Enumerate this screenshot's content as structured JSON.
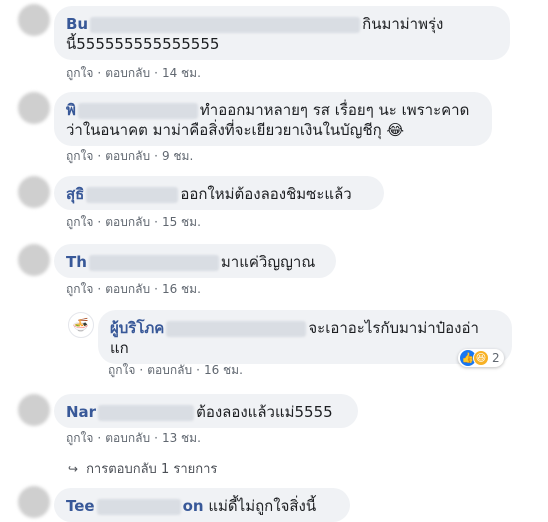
{
  "comments": [
    {
      "name": "Bu",
      "text": "กินมาม่าพรุ่งนี้555555555555555",
      "time": "14 ชม."
    },
    {
      "name": "พิ",
      "text": "ทำออกมาหลายๆ รส เรื่อยๆ นะ เพราะคาดว่าในอนาคต มาม่าคือสิ่งที่จะเยียวยาเงินในบัญชีกุ",
      "emoji": "😂",
      "time": "9 ชม."
    },
    {
      "name": "สุธิ",
      "text": "ออกใหม่ต้องลองชิมซะแล้ว",
      "time": "15 ชม."
    },
    {
      "name": "Th",
      "text": "มาแค่วิญญาณ",
      "time": "16 ชม."
    },
    {
      "name": "Nar",
      "text": "ต้องลองแล้วแม่5555",
      "time": "13 ชม."
    },
    {
      "name": "Tee",
      "name_tail": "on",
      "text": "แม่ดี้ไม่ถูกใจสิ่งนี้"
    }
  ],
  "reply": {
    "name": "ผู้บริโภค",
    "text_line1": "จะเอาอะไรกับมาม่าป๋องอ่า",
    "text_line2": "แก",
    "time": "16 ชม.",
    "reaction_count": "2"
  },
  "actions": {
    "like": "ถูกใจ",
    "reply": "ตอบกลับ",
    "sep": "·"
  },
  "view_replies": "การตอบกลับ 1 รายการ",
  "icons": {
    "like": "like-icon",
    "haha": "haha-icon",
    "reply_arrow": "reply-arrow-icon"
  }
}
